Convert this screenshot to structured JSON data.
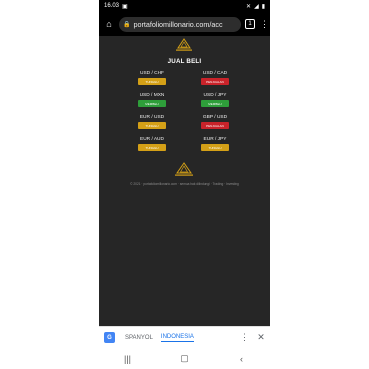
{
  "status_bar": {
    "time": "16.03",
    "notification_icon": "image-icon",
    "right_icons": [
      "mute-icon",
      "signal-icon",
      "battery-icon"
    ]
  },
  "browser": {
    "url": "portafoliomillonario.com/acc",
    "tab_count": "1"
  },
  "page": {
    "title": "JUAL BELI",
    "pairs": [
      {
        "name": "USD / CHF",
        "signal": "TUNGGU",
        "color": "#d4a017"
      },
      {
        "name": "USD / CAD",
        "signal": "PENJUALAN",
        "color": "#c9232a"
      },
      {
        "name": "USD / MXN",
        "signal": "MEMBELI",
        "color": "#2e9e3a"
      },
      {
        "name": "USD / JPY",
        "signal": "MEMBELI",
        "color": "#2e9e3a"
      },
      {
        "name": "EUR / USD",
        "signal": "TUNGGU",
        "color": "#d4a017"
      },
      {
        "name": "GBP / USD",
        "signal": "PENJUALAN",
        "color": "#c9232a"
      },
      {
        "name": "EUR / AUD",
        "signal": "TUNGGU",
        "color": "#d4a017"
      },
      {
        "name": "EUR / JPY",
        "signal": "TUNGGU",
        "color": "#d4a017"
      }
    ],
    "footer": "© 2021 · portafoliomillonario.com · semua hak dilindungi · Trading · Investing"
  },
  "translate_bar": {
    "icon": "google-translate-icon",
    "lang_source": "SPANYOL",
    "lang_target": "INDONESIA"
  },
  "colors": {
    "gold": "#d4a017",
    "page_bg": "#262626",
    "accent_blue": "#1a73e8"
  }
}
